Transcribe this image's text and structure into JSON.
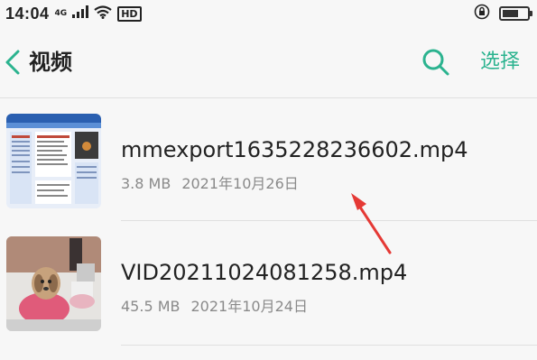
{
  "status_bar": {
    "time": "14:04",
    "network": "4G",
    "hd_badge": "HD",
    "battery_level": 0.65,
    "icons": [
      "signal-icon",
      "wifi-icon",
      "rotation-lock-icon",
      "battery-icon"
    ]
  },
  "app_bar": {
    "back_icon": "chevron-left-icon",
    "title": "视频",
    "search_icon": "search-icon",
    "select_label": "选择",
    "accent_color": "#2bb38f"
  },
  "files": [
    {
      "name": "mmexport1635228236602.mp4",
      "size": "3.8 MB",
      "date": "2021年10月26日",
      "thumbnail": "webpage-screenshot-thumbnail"
    },
    {
      "name": "VID20211024081258.mp4",
      "size": "45.5 MB",
      "date": "2021年10月24日",
      "thumbnail": "dog-photo-thumbnail"
    }
  ],
  "annotation": {
    "type": "red-arrow",
    "color": "#e53935"
  }
}
